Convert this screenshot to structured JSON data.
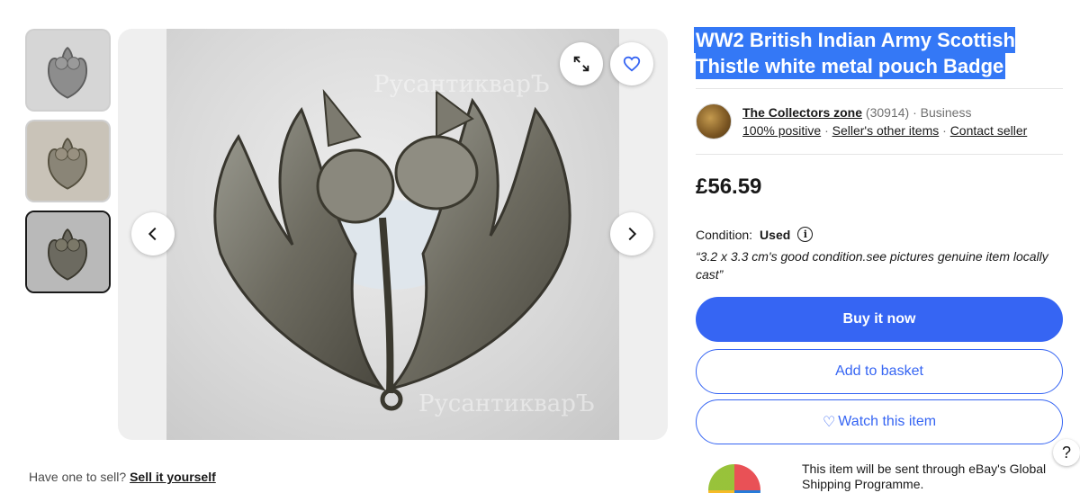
{
  "gallery": {
    "thumbnails": [
      {
        "selected": false
      },
      {
        "selected": false
      },
      {
        "selected": true
      }
    ],
    "watermark": "РусантикварЪ"
  },
  "listing": {
    "title": "WW2 British Indian Army Scottish Thistle white metal pouch Badge",
    "seller": {
      "name": "The Collectors zone",
      "feedback_count": "(30914)",
      "separator": "·",
      "type": "Business",
      "positive": "100% positive",
      "other_items": "Seller's other items",
      "contact": "Contact seller"
    },
    "price": "£56.59",
    "condition": {
      "label": "Condition:",
      "value": "Used",
      "info_glyph": "i",
      "note": "“3.2 x 3.3 cm's good condition.see pictures genuine item locally cast”"
    },
    "buttons": {
      "buy": "Buy it now",
      "basket": "Add to basket",
      "watch_icon": "♡",
      "watch": "Watch this item"
    },
    "shipping_note": "This item will be sent through eBay's Global Shipping Programme."
  },
  "footer": {
    "sell_prompt": "Have one to sell?",
    "sell_link": "Sell it yourself"
  },
  "help_glyph": "?",
  "colors": {
    "primary": "#3665f3",
    "title_highlight": "#3478f6",
    "text": "#191919"
  }
}
